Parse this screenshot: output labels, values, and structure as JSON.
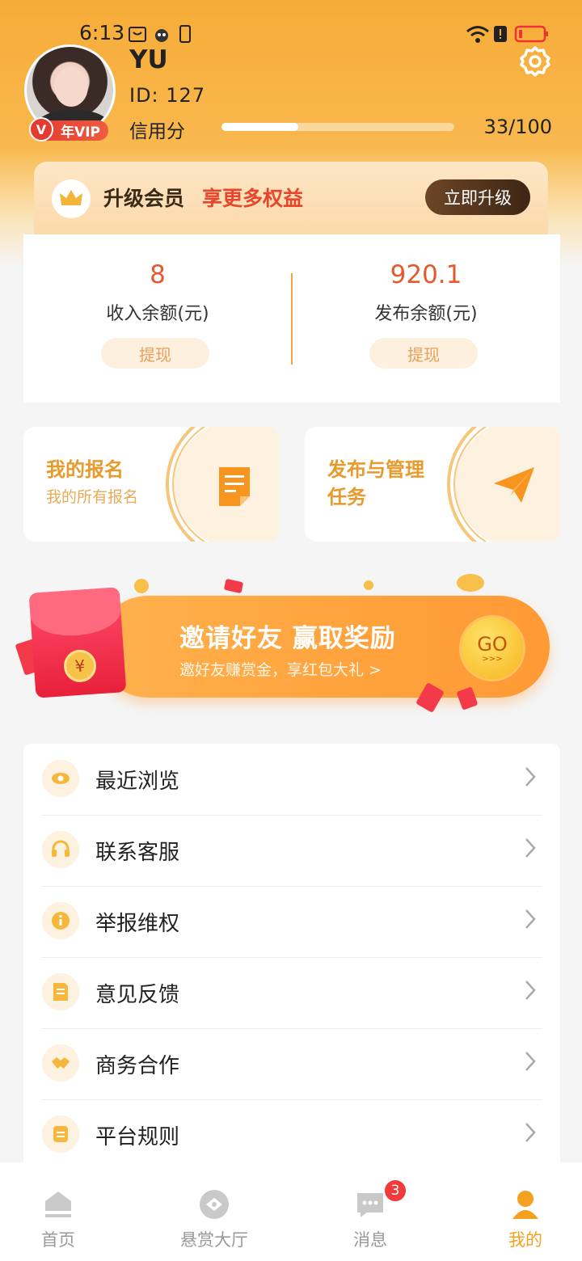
{
  "status_bar": {
    "time": "6:13"
  },
  "profile": {
    "name": "YU",
    "id_text": "ID:  127",
    "vip_label": "年VIP",
    "vip_mark": "V",
    "credit_label": "信用分",
    "credit_value": "33/100",
    "credit_fraction": 0.33
  },
  "upgrade": {
    "title": "升级会员",
    "subtitle": "享更多权益",
    "button": "立即升级"
  },
  "balance": {
    "income": {
      "value": "8",
      "label": "收入余额(元)",
      "button": "提现"
    },
    "publish": {
      "value": "920.1",
      "label": "发布余额(元)",
      "button": "提现"
    }
  },
  "actions": {
    "my_signups": {
      "title": "我的报名",
      "subtitle": "我的所有报名"
    },
    "publish_manage": {
      "title": "发布与管理任务"
    }
  },
  "invite": {
    "title": "邀请好友 赢取奖励",
    "subtitle": "邀好友赚赏金，享红包大礼 >",
    "go": "GO",
    "go_arrows": ">>>",
    "coin_symbol": "¥"
  },
  "menu": [
    {
      "label": "最近浏览",
      "icon": "eye-icon"
    },
    {
      "label": "联系客服",
      "icon": "headset-icon"
    },
    {
      "label": "举报维权",
      "icon": "info-icon"
    },
    {
      "label": "意见反馈",
      "icon": "feedback-icon"
    },
    {
      "label": "商务合作",
      "icon": "handshake-icon"
    },
    {
      "label": "平台规则",
      "icon": "rules-icon"
    }
  ],
  "tabbar": [
    {
      "label": "首页",
      "icon": "home-icon"
    },
    {
      "label": "悬赏大厅",
      "icon": "hall-icon"
    },
    {
      "label": "消息",
      "icon": "message-icon",
      "badge": "3"
    },
    {
      "label": "我的",
      "icon": "profile-icon",
      "active": true
    }
  ],
  "colors": {
    "brand_orange": "#f7ac38",
    "accent_red": "#e45a2e",
    "tab_active": "#f3a11e"
  }
}
